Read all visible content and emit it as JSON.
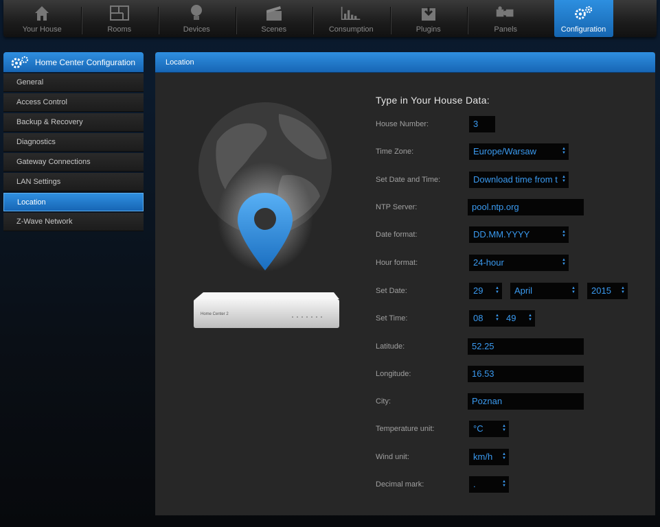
{
  "nav": {
    "items": [
      {
        "label": "Your House",
        "icon": "house-icon"
      },
      {
        "label": "Rooms",
        "icon": "floorplan-icon"
      },
      {
        "label": "Devices",
        "icon": "bulb-icon"
      },
      {
        "label": "Scenes",
        "icon": "clapperboard-icon"
      },
      {
        "label": "Consumption",
        "icon": "chart-icon"
      },
      {
        "label": "Plugins",
        "icon": "download-box-icon"
      },
      {
        "label": "Panels",
        "icon": "puzzle-icon"
      },
      {
        "label": "Configuration",
        "icon": "gears-icon"
      }
    ],
    "active_index": 7
  },
  "sidebar": {
    "header": "Home Center Configuration",
    "items": [
      {
        "label": "General"
      },
      {
        "label": "Access Control"
      },
      {
        "label": "Backup & Recovery"
      },
      {
        "label": "Diagnostics"
      },
      {
        "label": "Gateway Connections"
      },
      {
        "label": "LAN Settings"
      },
      {
        "label": "Location"
      },
      {
        "label": "Z-Wave Network"
      }
    ],
    "active_index": 6
  },
  "panel": {
    "title": "Location",
    "form_title": "Type in Your House Data:",
    "device_label": "Home Center 2",
    "fields": {
      "house_number": {
        "label": "House Number:",
        "value": "3"
      },
      "time_zone": {
        "label": "Time Zone:",
        "value": "Europe/Warsaw"
      },
      "set_date_time": {
        "label": "Set Date and Time:",
        "value": "Download time from t"
      },
      "ntp_server": {
        "label": "NTP Server:",
        "value": "pool.ntp.org"
      },
      "date_format": {
        "label": "Date format:",
        "value": "DD.MM.YYYY"
      },
      "hour_format": {
        "label": "Hour format:",
        "value": "24-hour"
      },
      "set_date": {
        "label": "Set Date:",
        "day": "29",
        "month": "April",
        "year": "2015"
      },
      "set_time": {
        "label": "Set Time:",
        "hour": "08",
        "minute": "49"
      },
      "latitude": {
        "label": "Latitude:",
        "value": "52.25"
      },
      "longitude": {
        "label": "Longitude:",
        "value": "16.53"
      },
      "city": {
        "label": "City:",
        "value": "Poznan"
      },
      "temperature_unit": {
        "label": "Temperature unit:",
        "value": "°C"
      },
      "wind_unit": {
        "label": "Wind unit:",
        "value": "km/h"
      },
      "decimal_mark": {
        "label": "Decimal mark:",
        "value": "."
      }
    }
  },
  "colors": {
    "accent": "#1f7bd0",
    "field_text": "#3a9af0",
    "field_bg": "#050505",
    "panel_bg": "#272727"
  }
}
